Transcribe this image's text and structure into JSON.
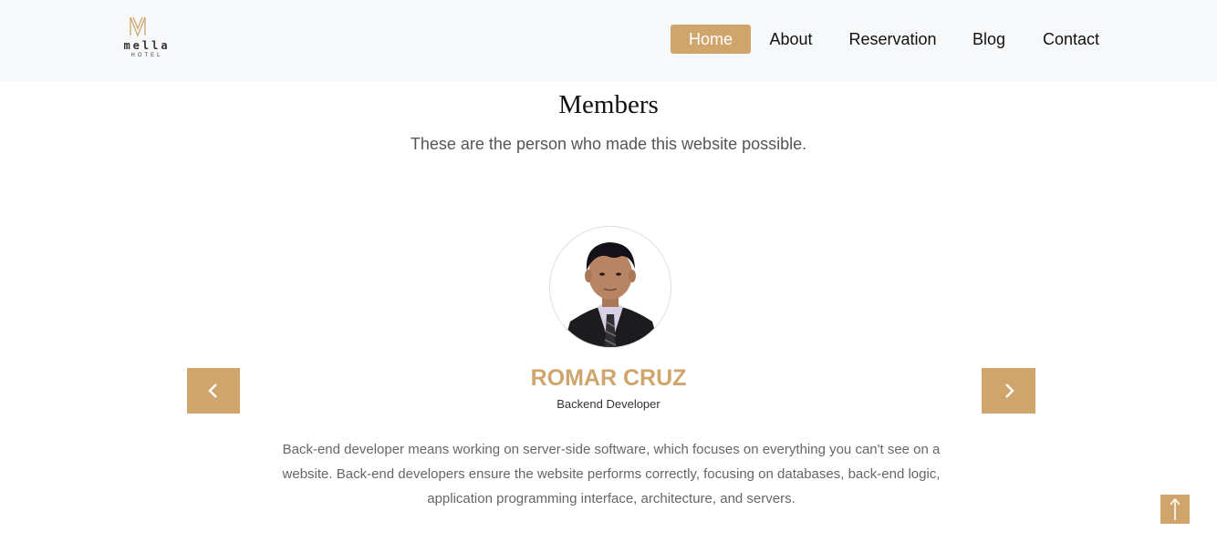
{
  "brand": {
    "logo_mark": "M",
    "name": "mella",
    "tagline": "HOTEL"
  },
  "nav": {
    "items": [
      {
        "label": "Home",
        "active": true
      },
      {
        "label": "About",
        "active": false
      },
      {
        "label": "Reservation",
        "active": false
      },
      {
        "label": "Blog",
        "active": false
      },
      {
        "label": "Contact",
        "active": false
      }
    ]
  },
  "section": {
    "title": "Members",
    "subtitle": "These are the person who made this website possible."
  },
  "member": {
    "name": "ROMAR CRUZ",
    "role": "Backend Developer",
    "description": "Back-end developer means working on server-side software, which focuses on everything you can't see on a website. Back-end developers ensure the website performs correctly, focusing on databases, back-end logic, application programming interface, architecture, and servers."
  },
  "icons": {
    "prev": "chevron-left-icon",
    "next": "chevron-right-icon",
    "back_to_top": "arrow-up-icon"
  },
  "colors": {
    "accent": "#cfa56c",
    "navbar_bg": "#f7f8fa",
    "text_dark": "#111111",
    "text_muted": "#666666"
  }
}
